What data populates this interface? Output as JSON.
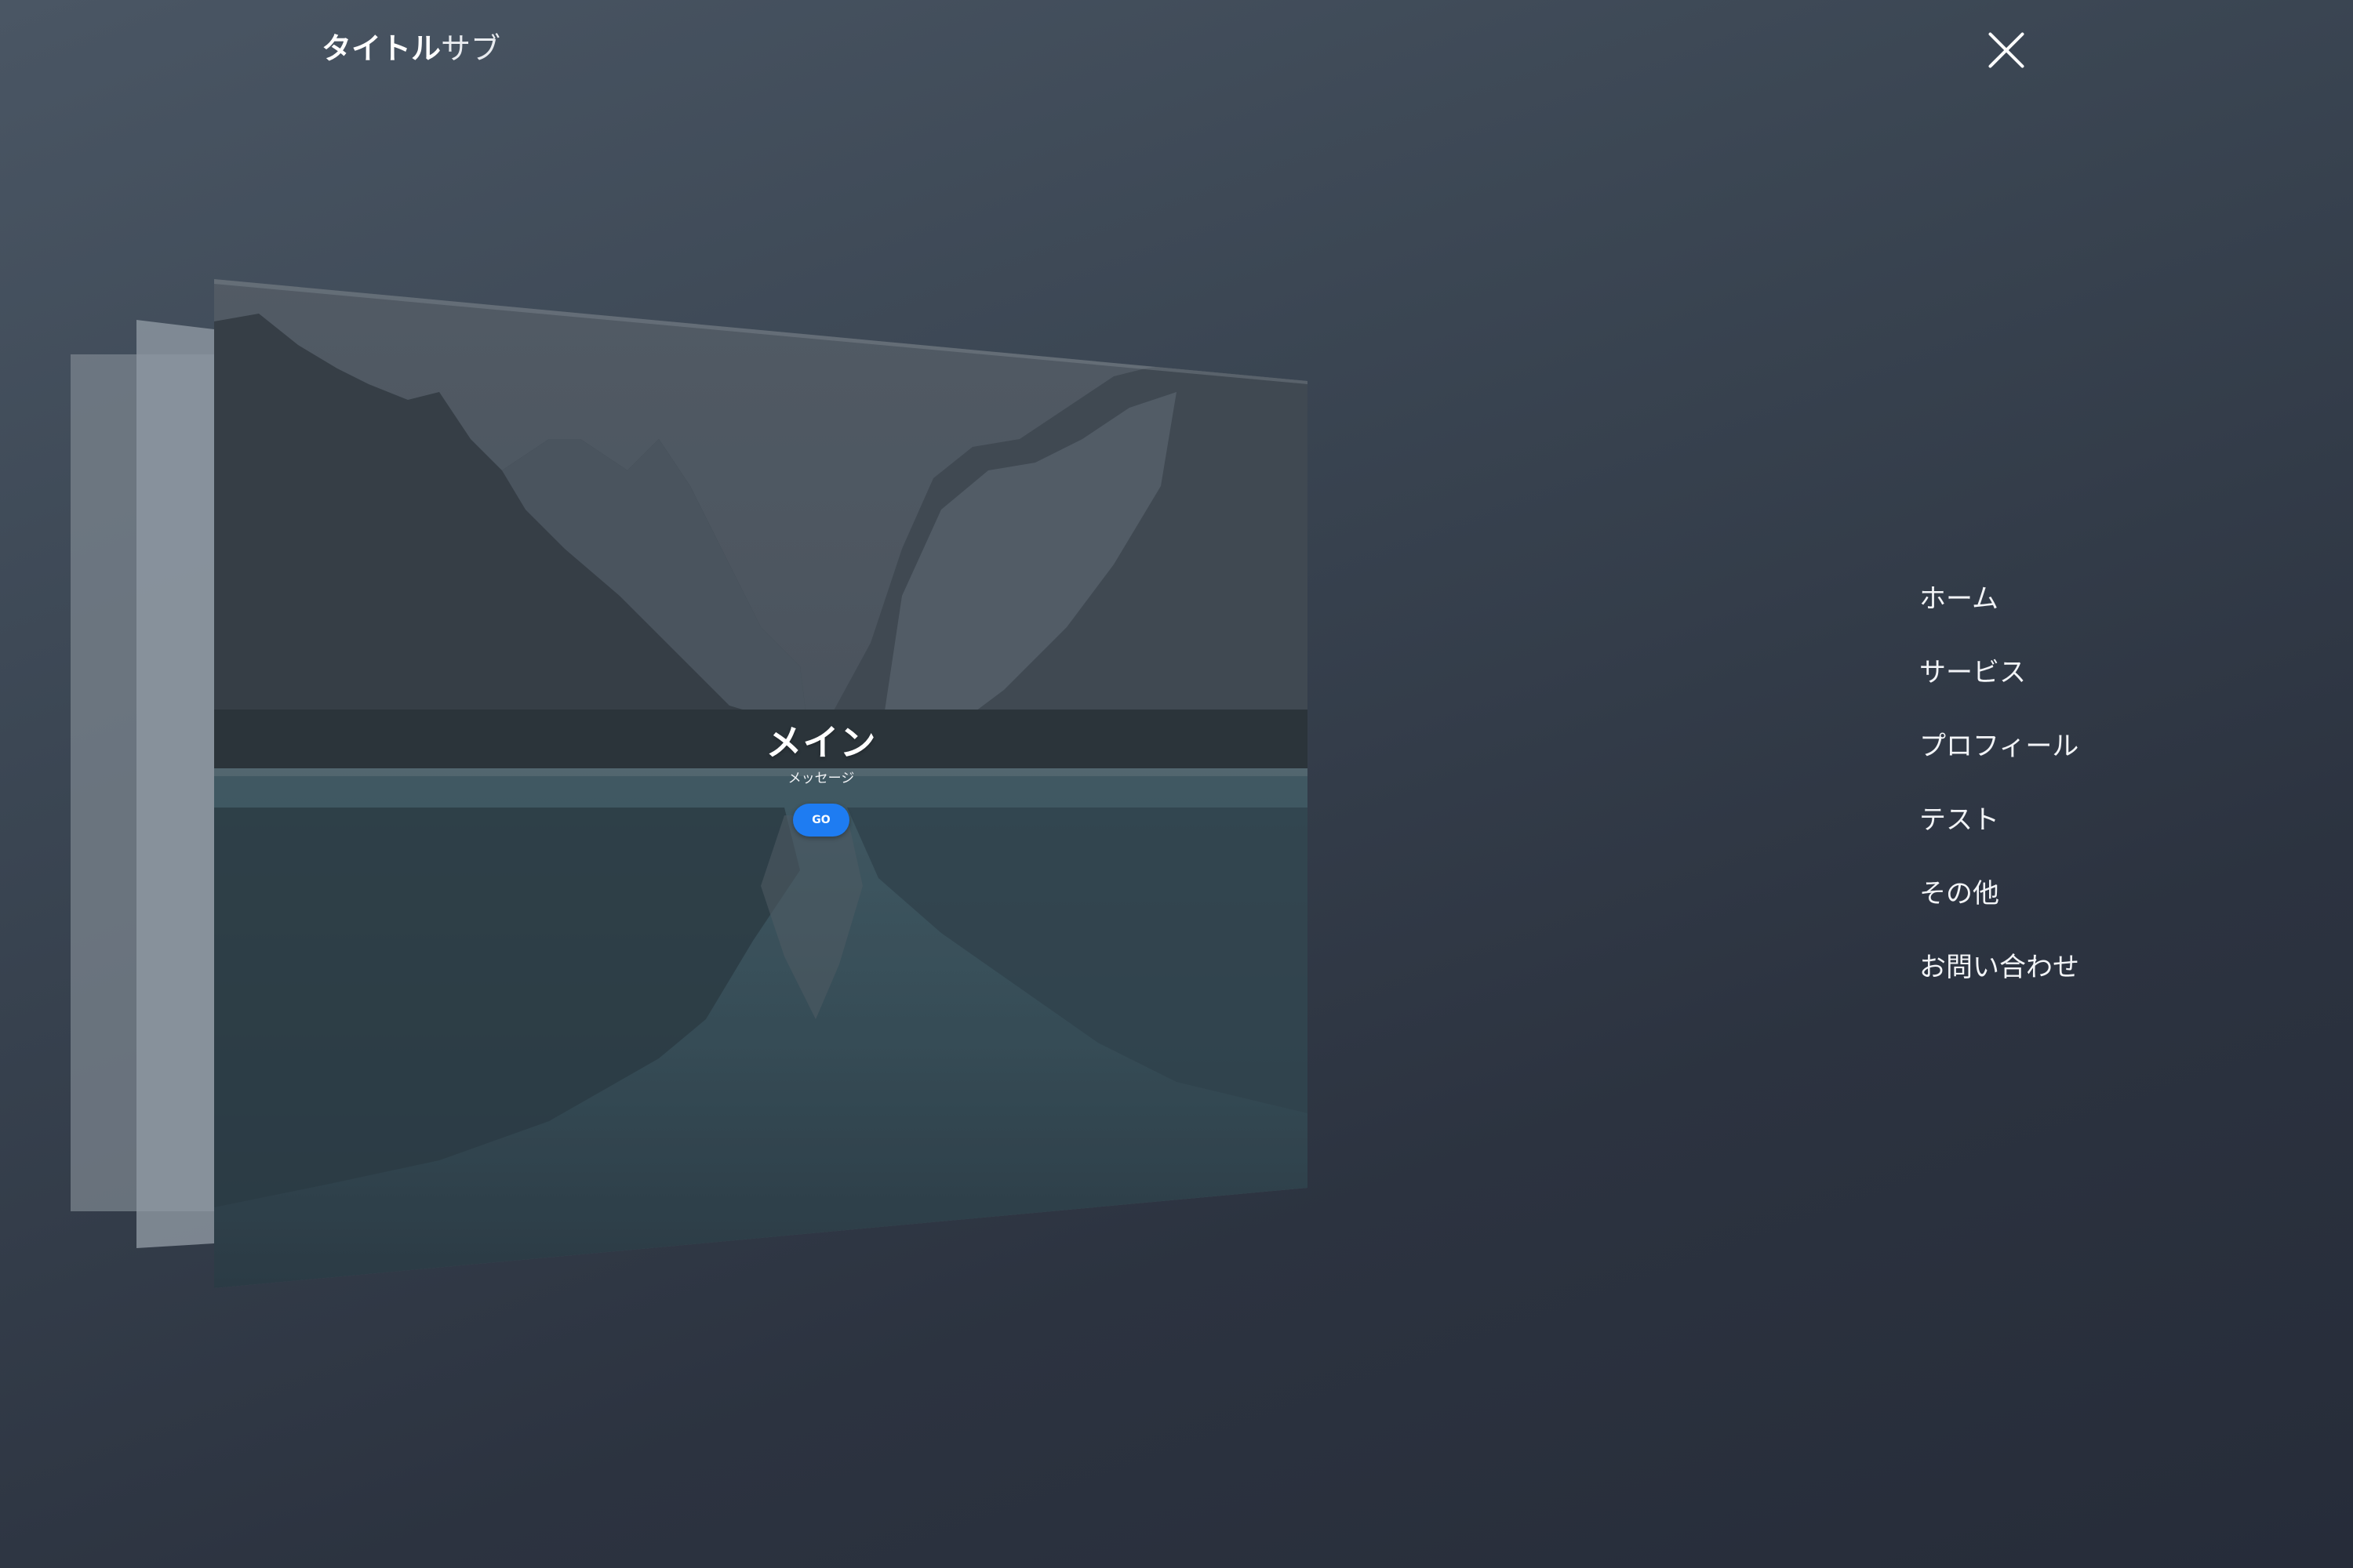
{
  "header": {
    "brand_main": "タイトル",
    "brand_sub": "サブ"
  },
  "hero": {
    "title": "メイン",
    "message": "メッセージ",
    "button_label": "GO"
  },
  "menu": {
    "items": [
      {
        "label": "ホーム"
      },
      {
        "label": "サービス"
      },
      {
        "label": "プロフィール"
      },
      {
        "label": "テスト"
      },
      {
        "label": "その他"
      },
      {
        "label": "お問い合わせ"
      }
    ]
  },
  "icons": {
    "close": "close-icon"
  },
  "colors": {
    "background": "#36404d",
    "accent_button": "#1e7cf2",
    "text": "#ffffff"
  }
}
